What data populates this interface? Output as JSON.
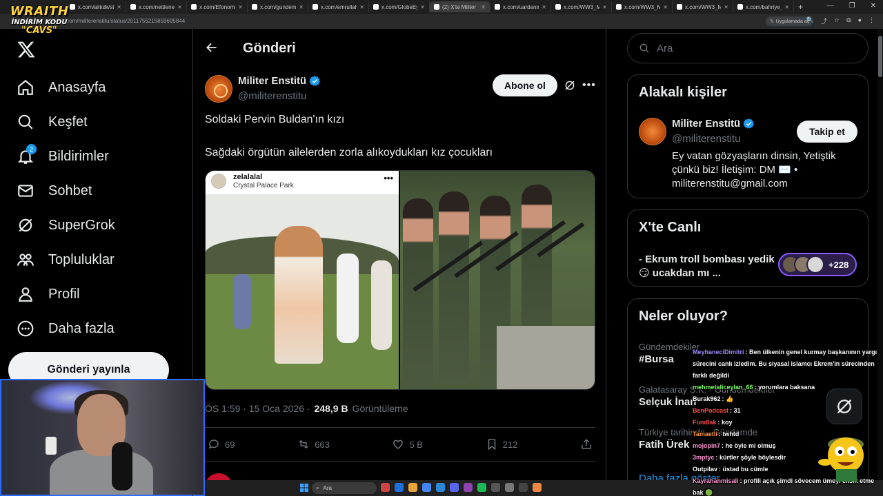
{
  "browser": {
    "tabs": [
      {
        "label": "x.com/alikdk/statu"
      },
      {
        "label": "x.com/nettleneedst"
      },
      {
        "label": "x.com/Efonomizme"
      },
      {
        "label": "x.com/gundemrapo"
      },
      {
        "label": "x.com/emrullaherd"
      },
      {
        "label": "x.com/GlobeEye"
      },
      {
        "label": "(2) X'te Militer Ensti"
      },
      {
        "label": "x.com/uardanino"
      },
      {
        "label": "x.com/WW3_Moni"
      },
      {
        "label": "x.com/WW3_Moni"
      },
      {
        "label": "x.com/WW3_Moni"
      },
      {
        "label": "x.com/bahriye_uco"
      }
    ],
    "url": "x.com/militerenstitu/status/2011755215859695844",
    "app_pill": "Uygulamada aç"
  },
  "overlay": {
    "brand_name": "WRAITH",
    "code_label": "İNDİRİM KODU",
    "code_value": "\"CAVS\""
  },
  "nav": {
    "items": [
      {
        "label": "Anasayfa",
        "icon": "home-icon"
      },
      {
        "label": "Keşfet",
        "icon": "search-icon"
      },
      {
        "label": "Bildirimler",
        "icon": "bell-icon",
        "badge": "2"
      },
      {
        "label": "Sohbet",
        "icon": "mail-icon"
      },
      {
        "label": "SuperGrok",
        "icon": "grok-icon"
      },
      {
        "label": "Topluluklar",
        "icon": "people-icon"
      },
      {
        "label": "Profil",
        "icon": "user-icon"
      },
      {
        "label": "Daha fazla",
        "icon": "more-circle-icon"
      }
    ],
    "post_button": "Gönderi yayınla"
  },
  "post": {
    "header_title": "Gönderi",
    "author_name": "Militer Enstitü",
    "author_handle": "@militerenstitu",
    "subscribe_label": "Abone ol",
    "text_line1": "Soldaki Pervin Buldan'ın kızı",
    "text_line2": "Sağdaki örgütün ailelerden zorla alıkoydukları kız çocukları",
    "embed_user": "zelalalal",
    "embed_location": "Crystal Palace Park",
    "time": "ÖS 1:59 · 15 Oca 2026 ·",
    "views": "248,9 B",
    "views_label": "Görüntüleme",
    "replies": "69",
    "reposts": "663",
    "likes": "5 B",
    "bookmarks": "212"
  },
  "sidebar": {
    "search_placeholder": "Ara",
    "related_title": "Alakalı kişiler",
    "related_name": "Militer Enstitü",
    "related_handle": "@militerenstitu",
    "related_bio": "Ey vatan gözyaşların dinsin, Yetiştik çünkü biz! İletişim: DM ✉️ • militerenstitu@gmail.com",
    "follow_label": "Takip et",
    "live_title": "X'te Canlı",
    "live_text": "- Ekrum troll bombası yedik 😏 ucakdan mı ...",
    "live_count": "+228",
    "happening_title": "Neler oluyor?",
    "trends": [
      {
        "category": "Gündemdekiler",
        "title": "#Bursa"
      },
      {
        "category": "Galatasaray S.K. · Gündemdekiler",
        "title": "Selçuk İnan"
      },
      {
        "category": "Türkiye tarihinde · Gündemde",
        "title": "Fatih Ürek"
      }
    ],
    "show_more": "Daha fazla göster"
  },
  "chat": [
    {
      "user": "MeyhaneciDimitri",
      "color": "#9b8cff",
      "msg": "Ben ülkenin genel kurmay başkanının yargı sürecini canlı izledim. Bu siyasal islamcı Ekrem'in sürecinden farklı değildi"
    },
    {
      "user": "mehmetaliceylan_66",
      "color": "#7cff6b",
      "msg": "yorumlara baksana"
    },
    {
      "user": "Burak962",
      "color": "#ffffff",
      "msg": "👍"
    },
    {
      "user": "BenPodcast",
      "color": "#ff4d4d",
      "msg": "31"
    },
    {
      "user": "Fundlak",
      "color": "#ff4d4d",
      "msg": "koy"
    },
    {
      "user": "Tamaetli",
      "color": "#ff9a3c",
      "msg": "twhtd"
    },
    {
      "user": "mojopin7",
      "color": "#ff9ad5",
      "msg": "he öyle mi olmuş"
    },
    {
      "user": "3mptyc",
      "color": "#ff9ad5",
      "msg": "kürtler şöyle böylesdir"
    },
    {
      "user": "Outpilav",
      "color": "#ffffff",
      "msg": "üstad bu cümle"
    },
    {
      "user": "Kayrahanmisali",
      "color": "#ff9ad5",
      "msg": "profili açık şimdi sövecem ümeyi eksik etme bak 🟢"
    }
  ],
  "taskbar": {
    "search_placeholder": "Ara"
  },
  "colors": {
    "accent": "#1d9bf0",
    "verified": "#1d9bf0",
    "border": "#2f3336",
    "muted": "#71767b"
  }
}
